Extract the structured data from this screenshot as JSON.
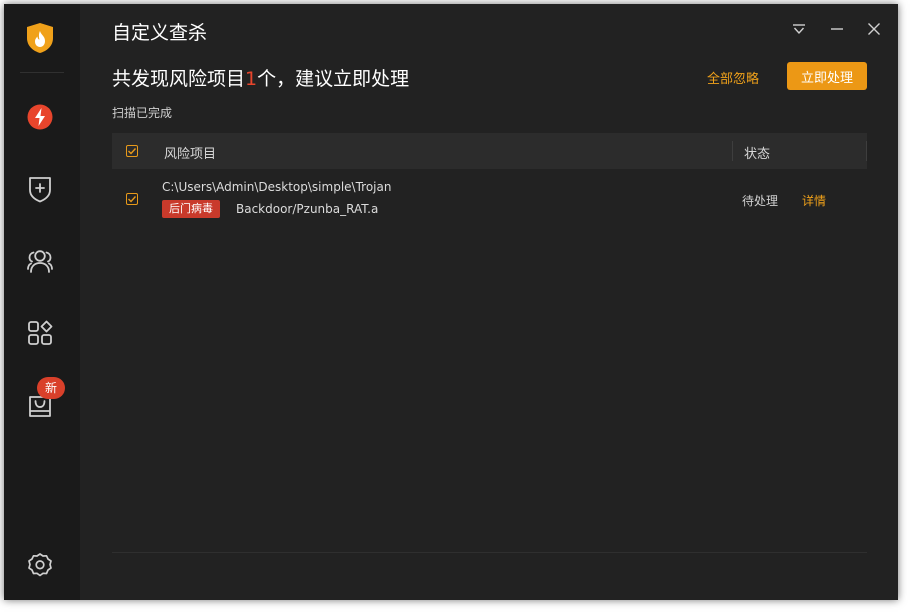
{
  "window": {
    "title": "自定义查杀",
    "controls": [
      "menu-icon",
      "minimize-icon",
      "close-icon"
    ]
  },
  "sidebar": {
    "items": [
      {
        "name": "logo",
        "icon": "fire-shield-icon"
      },
      {
        "name": "quick-scan",
        "icon": "lightning-icon",
        "active": true
      },
      {
        "name": "protection",
        "icon": "shield-plus-icon"
      },
      {
        "name": "account",
        "icon": "users-icon"
      },
      {
        "name": "apps",
        "icon": "apps-icon"
      },
      {
        "name": "store",
        "icon": "bag-icon",
        "badge": "新"
      },
      {
        "name": "settings",
        "icon": "gear-icon"
      }
    ]
  },
  "summary": {
    "prefix": "共发现风险项目",
    "count": "1",
    "suffix": "个，建议立即处理",
    "status": "扫描已完成",
    "ignore_all": "全部忽略",
    "fix_now": "立即处理"
  },
  "table": {
    "columns": {
      "item": "风险项目",
      "status": "状态"
    },
    "rows": [
      {
        "path": "C:\\Users\\Admin\\Desktop\\simple\\Trojan",
        "tag": "后门病毒",
        "threat": "Backdoor/Pzunba_RAT.a",
        "state": "待处理",
        "detail": "详情",
        "checked": true
      }
    ]
  },
  "colors": {
    "accent": "#ec9815",
    "danger": "#e8452c",
    "background": "#222222",
    "sidebar": "#1a1a1a"
  }
}
